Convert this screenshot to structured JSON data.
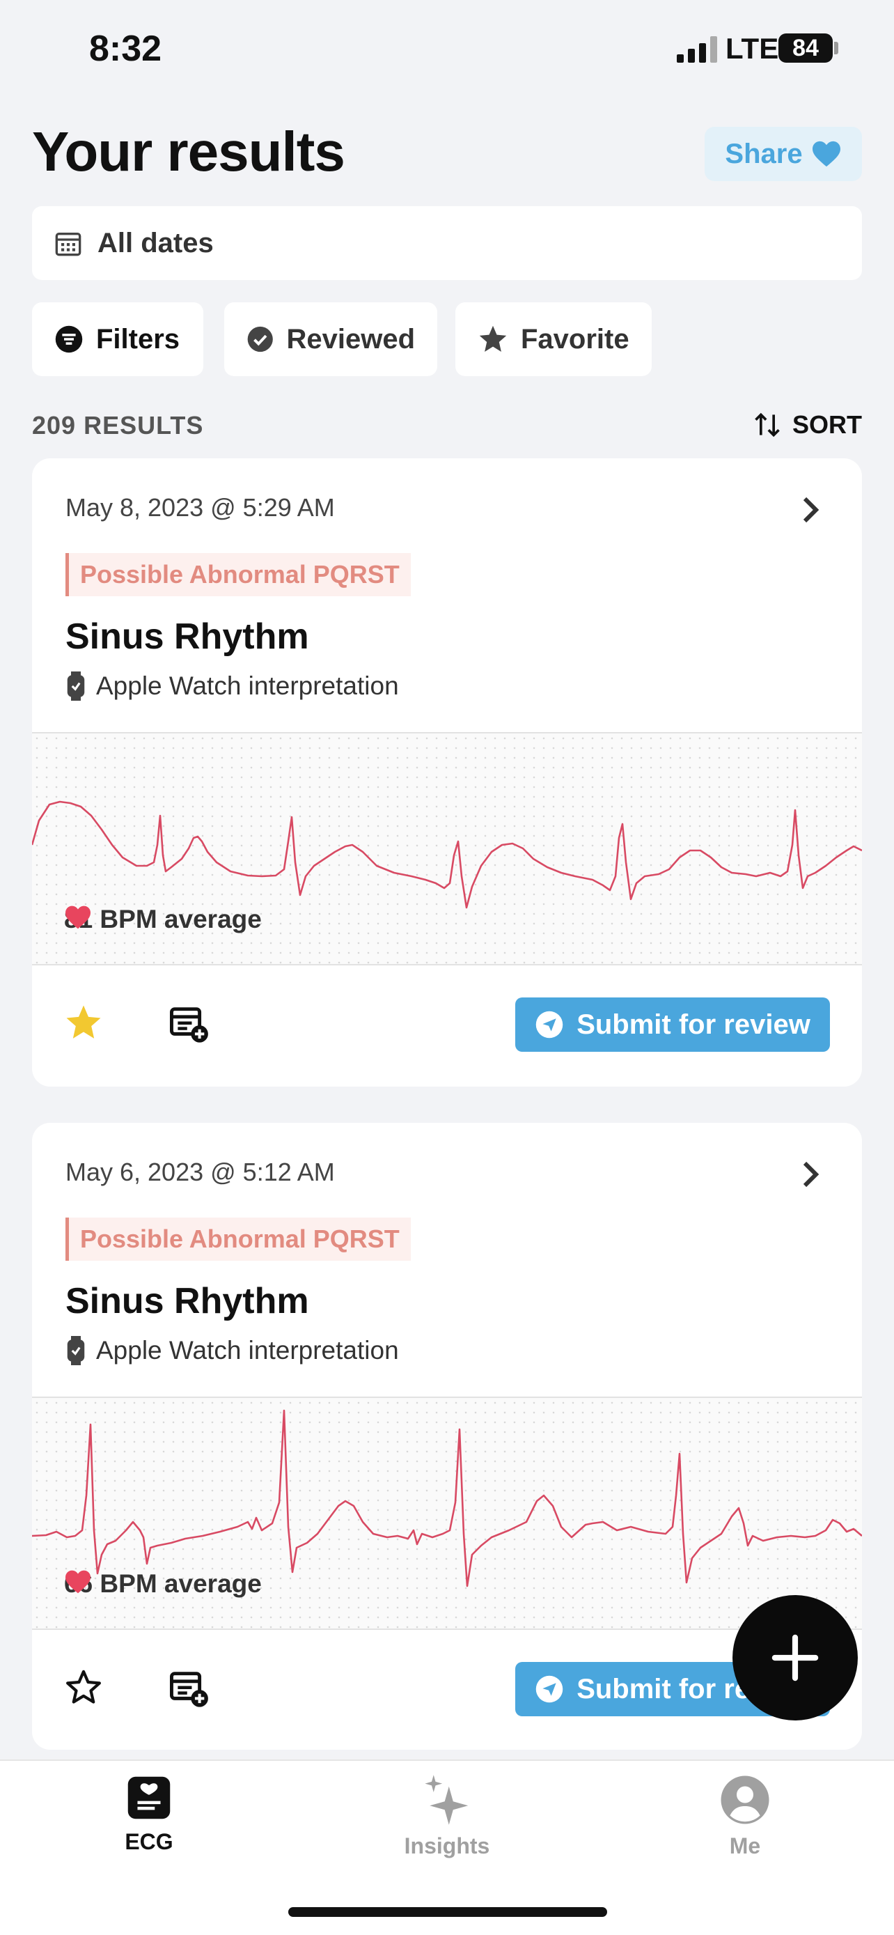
{
  "status_bar": {
    "time": "8:32",
    "network": "LTE",
    "battery": "84"
  },
  "header": {
    "title": "Your results",
    "share_label": "Share"
  },
  "date_filter": {
    "label": "All dates"
  },
  "filter_chips": [
    {
      "label": "Filters",
      "icon": "filter-icon"
    },
    {
      "label": "Reviewed",
      "icon": "check-circle-icon"
    },
    {
      "label": "Favorite",
      "icon": "star-icon"
    }
  ],
  "results": {
    "count_label": "209 RESULTS",
    "sort_label": "SORT"
  },
  "cards": [
    {
      "date": "May 8, 2023 @ 5:29 AM",
      "tag": "Possible Abnormal PQRST",
      "rhythm": "Sinus Rhythm",
      "interpretation": "Apple Watch interpretation",
      "bpm": "81 BPM average",
      "favorited": true,
      "submit_label": "Submit for review"
    },
    {
      "date": "May 6, 2023 @ 5:12 AM",
      "tag": "Possible Abnormal PQRST",
      "rhythm": "Sinus Rhythm",
      "interpretation": "Apple Watch interpretation",
      "bpm": "66 BPM average",
      "favorited": false,
      "submit_label": "Submit for review"
    }
  ],
  "tabs": [
    {
      "label": "ECG",
      "icon": "ecg-icon",
      "active": true
    },
    {
      "label": "Insights",
      "icon": "sparkle-icon",
      "active": false
    },
    {
      "label": "Me",
      "icon": "profile-icon",
      "active": false
    }
  ],
  "colors": {
    "accent": "#4aa6dd",
    "tag": "#e28b80",
    "ecg_line": "#d84a63",
    "heart": "#e8455e",
    "star": "#f2c830"
  }
}
